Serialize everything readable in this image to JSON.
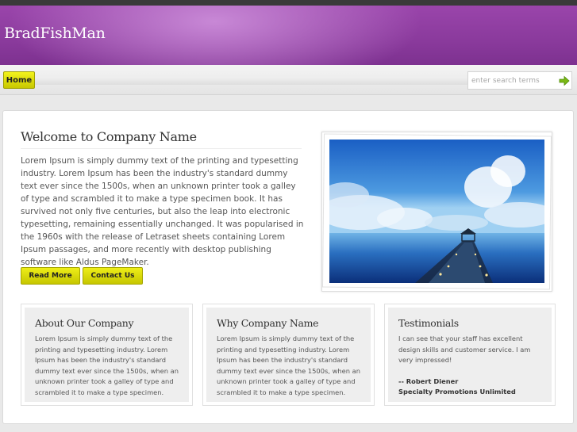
{
  "site": {
    "brand": "BradFishMan"
  },
  "nav": {
    "home_label": "Home"
  },
  "search": {
    "placeholder": "enter search terms"
  },
  "welcome": {
    "title": "Welcome to Company Name",
    "body": "Lorem Ipsum is simply dummy text of the printing and typesetting industry. Lorem Ipsum has been the industry's standard dummy text ever since the 1500s, when an unknown printer took a galley of type and scrambled it to make a type specimen book. It has survived not only five centuries, but also the leap into electronic typesetting, remaining essentially unchanged. It was popularised in the 1960s with the release of Letraset sheets containing Lorem Ipsum passages, and more recently with desktop publishing software like Aldus PageMaker.",
    "read_more": "Read More",
    "contact_us": "Contact Us"
  },
  "columns": {
    "about": {
      "title": "About Our Company",
      "body": "Lorem Ipsum is simply dummy text of the printing and typesetting industry. Lorem Ipsum has been the industry's standard dummy text ever since the 1500s, when an unknown printer took a galley of type and scrambled it to make a type specimen."
    },
    "why": {
      "title": "Why Company Name",
      "body": "Lorem Ipsum is simply dummy text of the printing and typesetting industry. Lorem Ipsum has been the industry's standard dummy text ever since the 1500s, when an unknown printer took a galley of type and scrambled it to make a type specimen."
    },
    "testimonials": {
      "title": "Testimonials",
      "quote": "I can see that your staff has excellent design skills and customer service. I am very impressed!",
      "author": "-- Robert Diener",
      "company": "Specialty Promotions Unlimited"
    }
  },
  "icons": {
    "search_go": "arrow-right-icon"
  },
  "colors": {
    "header_purple": "#8a3a9c",
    "button_yellow": "#dede0a",
    "top_bar": "#3a3a3a"
  }
}
